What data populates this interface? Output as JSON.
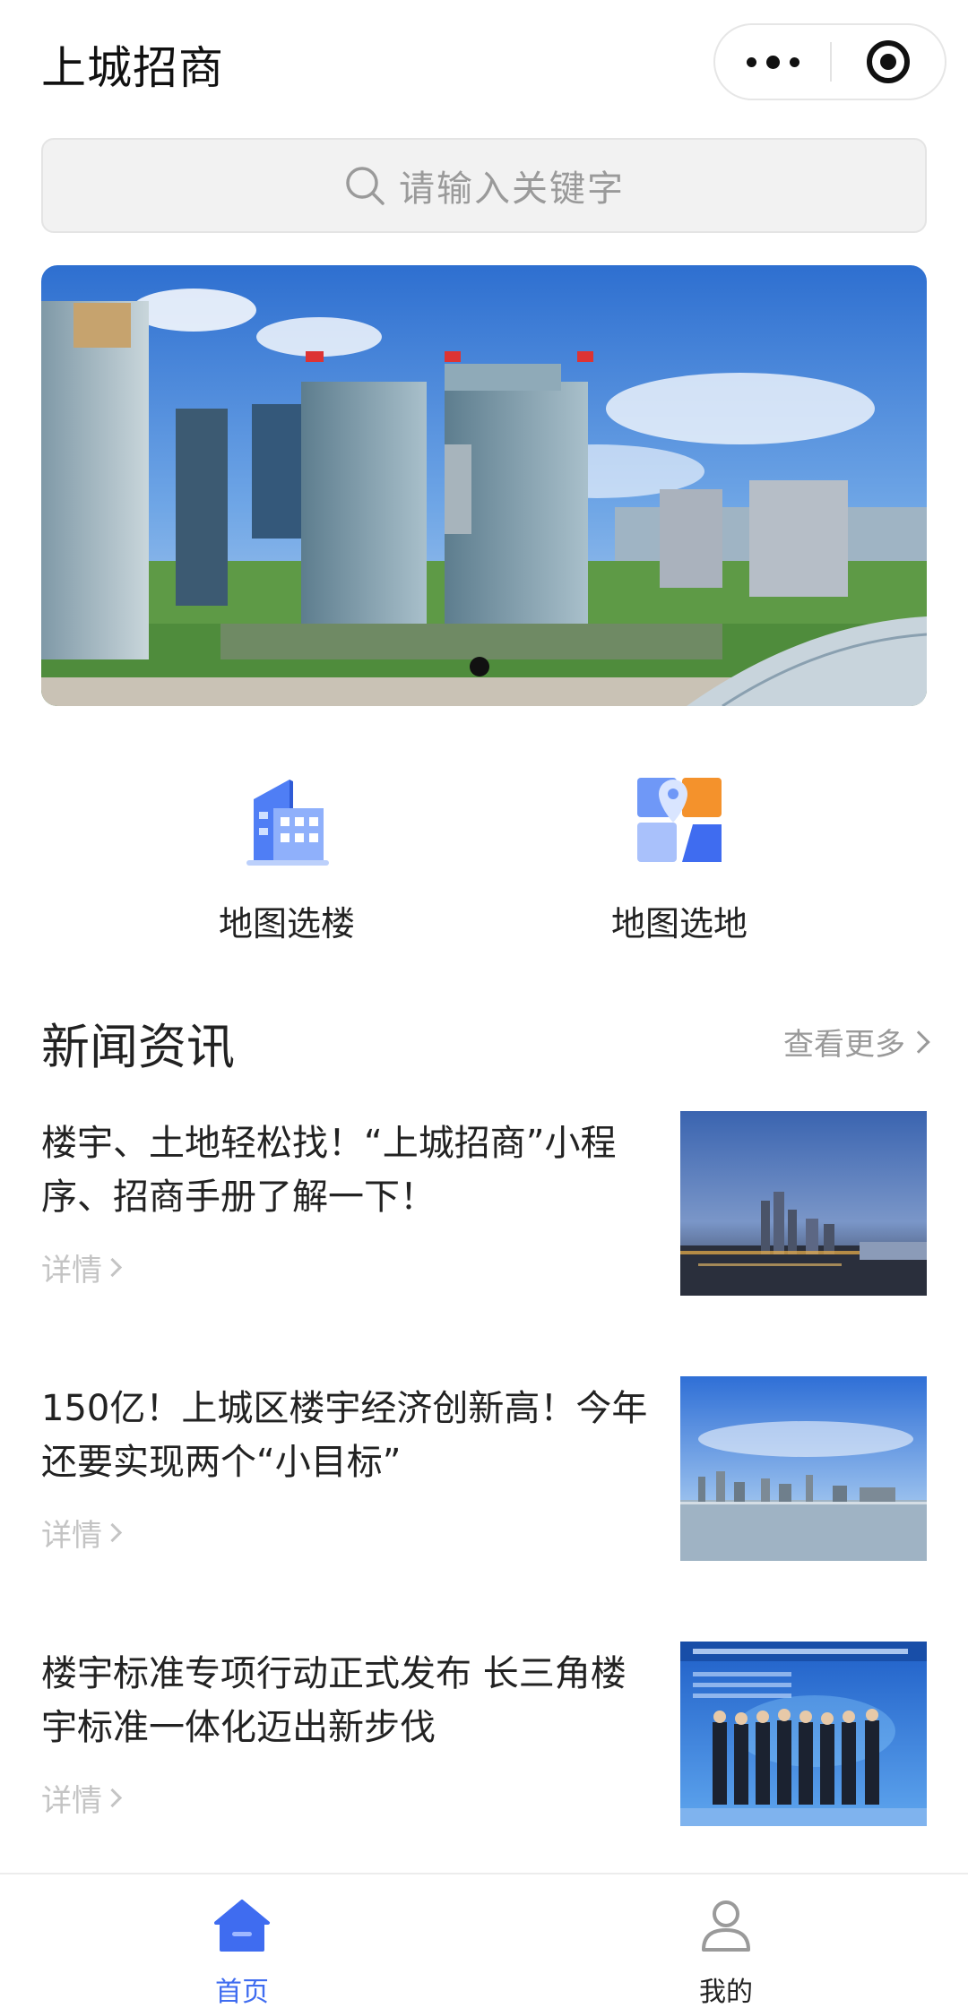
{
  "app": {
    "title": "上城招商"
  },
  "search": {
    "placeholder": "请输入关键字"
  },
  "banner": {
    "slide_count": 1,
    "active_slide": 1
  },
  "quick_entries": [
    {
      "label": "地图选楼",
      "icon": "building-icon"
    },
    {
      "label": "地图选地",
      "icon": "map-location-icon"
    }
  ],
  "news": {
    "section_title": "新闻资讯",
    "more_label": "查看更多",
    "items": [
      {
        "title": "楼宇、土地轻松找！“上城招商”小程序、招商手册了解一下！",
        "detail_label": "详情"
      },
      {
        "title": "150亿！上城区楼宇经济创新高！今年还要实现两个“小目标”",
        "detail_label": "详情"
      },
      {
        "title": "楼宇标准专项行动正式发布 长三角楼宇标准一体化迈出新步伐",
        "detail_label": "详情"
      }
    ]
  },
  "tabbar": {
    "items": [
      {
        "label": "首页",
        "icon": "home-icon",
        "active": true
      },
      {
        "label": "我的",
        "icon": "user-icon",
        "active": false
      }
    ]
  },
  "colors": {
    "accent": "#3F6CF0",
    "muted": "#999999",
    "detail": "#C4C4C4",
    "tab_inactive": "#222222"
  }
}
